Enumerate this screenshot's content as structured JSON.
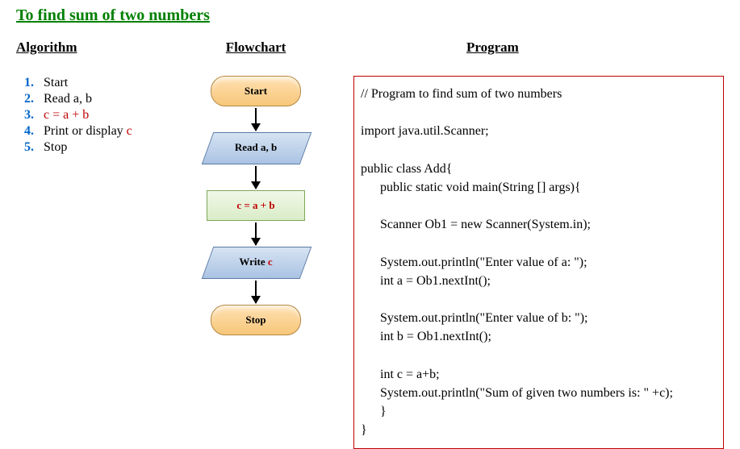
{
  "title": "To find sum of two numbers",
  "headers": {
    "algorithm": "Algorithm",
    "flowchart": "Flowchart",
    "program": "Program"
  },
  "algorithm": {
    "steps": [
      {
        "num": "1.",
        "text_before": "Start",
        "red": "",
        "text_after": ""
      },
      {
        "num": "2.",
        "text_before": "Read a, b",
        "red": "",
        "text_after": ""
      },
      {
        "num": "3.",
        "text_before": "",
        "red": "c = a + b",
        "text_after": ""
      },
      {
        "num": "4.",
        "text_before": "Print or display ",
        "red": "c",
        "text_after": ""
      },
      {
        "num": "5.",
        "text_before": "Stop",
        "red": "",
        "text_after": ""
      }
    ]
  },
  "flowchart": {
    "start": "Start",
    "read": "Read a, b",
    "process": "c = a + b",
    "write_prefix": "Write ",
    "write_var": "c",
    "stop": "Stop"
  },
  "program": {
    "code": "// Program to find sum of two numbers\n\nimport java.util.Scanner;\n\npublic class Add{\n      public static void main(String [] args){\n\n      Scanner Ob1 = new Scanner(System.in);\n\n      System.out.println(\"Enter value of a: \");\n      int a = Ob1.nextInt();\n\n      System.out.println(\"Enter value of b: \");\n      int b = Ob1.nextInt();\n\n      int c = a+b;\n      System.out.println(\"Sum of given two numbers is: \" +c);\n      }\n}"
  }
}
